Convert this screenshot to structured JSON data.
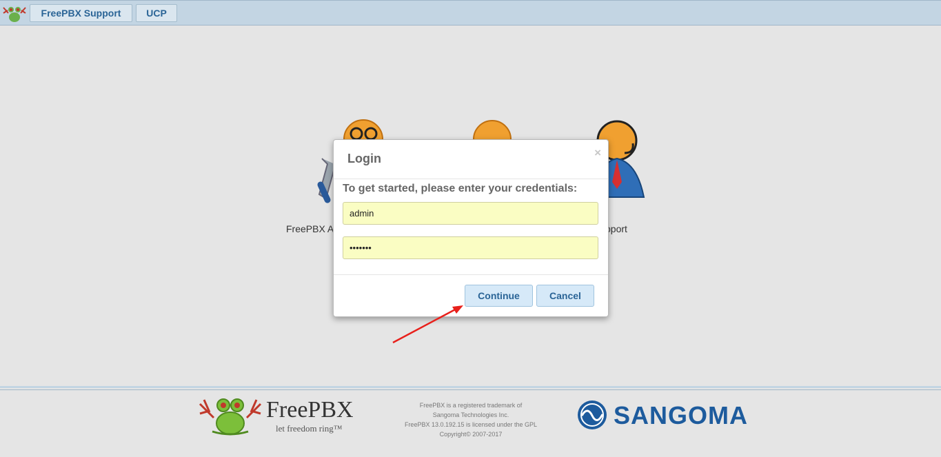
{
  "topbar": {
    "tabs": [
      {
        "label": "FreePBX Support"
      },
      {
        "label": "UCP"
      }
    ]
  },
  "background": {
    "labels": [
      "FreePBX A",
      "pport"
    ]
  },
  "modal": {
    "title": "Login",
    "close_glyph": "×",
    "prompt": "To get started, please enter your credentials:",
    "username_value": "admin",
    "password_value": "•••••••",
    "continue_label": "Continue",
    "cancel_label": "Cancel"
  },
  "footer": {
    "freepbx_brand": "FreePBX",
    "freepbx_tagline": "let freedom ring™",
    "legal": [
      "FreePBX is a registered trademark of",
      "Sangoma Technologies Inc.",
      "FreePBX 13.0.192.15 is licensed under the GPL",
      "Copyright© 2007-2017"
    ],
    "sangoma_brand": "SANGOMA"
  },
  "colors": {
    "topbar": "#c3d5e3",
    "accent_text": "#2a6496",
    "input_bg": "#fafdc3",
    "button_bg": "#d6e9f8",
    "annotation_arrow": "#e8201b",
    "sangoma_blue": "#1d5b9d"
  }
}
